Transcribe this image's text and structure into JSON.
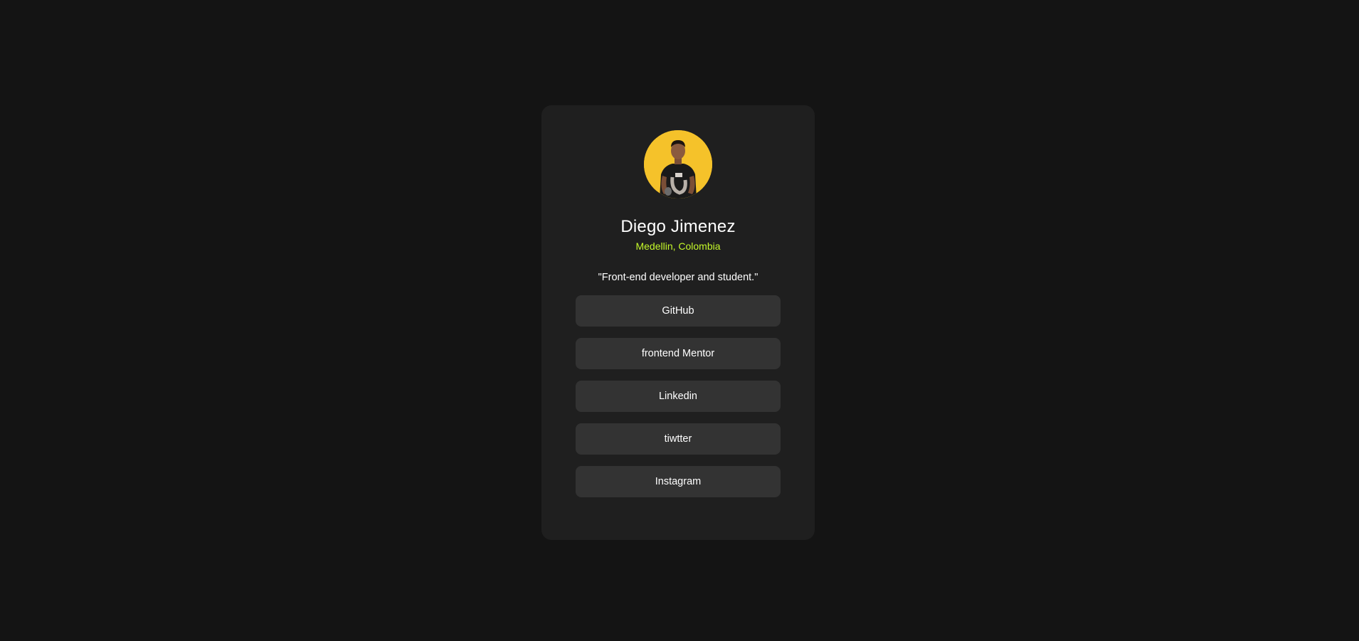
{
  "profile": {
    "avatar_icon": "profile-photo",
    "name": "Diego Jimenez",
    "location": "Medellin, Colombia",
    "bio": "\"Front-end developer and student.\""
  },
  "links": [
    {
      "label": "GitHub"
    },
    {
      "label": "frontend Mentor"
    },
    {
      "label": "Linkedin"
    },
    {
      "label": "tiwtter"
    },
    {
      "label": "Instagram"
    }
  ],
  "colors": {
    "background": "#141414",
    "card": "#1f1f1f",
    "button": "#333333",
    "accent": "#c4f82a",
    "avatar_bg": "#f5c22a"
  }
}
